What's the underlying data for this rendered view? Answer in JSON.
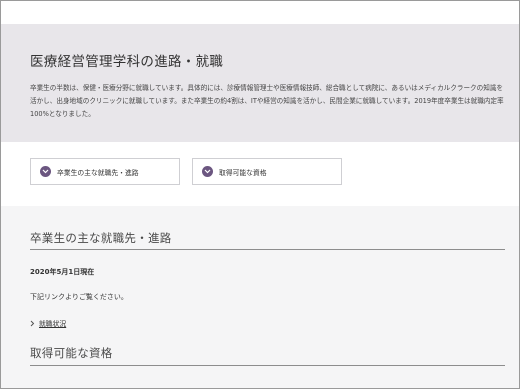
{
  "hero": {
    "title": "医療経営管理学科の進路・就職",
    "description": "卒業生の半数は、保健・医療分野に就職しています。具体的には、診療情報管理士や医療情報技師、総合職として病院に、あるいはメディカルクラークの知識を活かし、出身地域のクリニックに就職しています。また卒業生の約4割は、ITや経営の知識を活かし、民間企業に就職しています。2019年度卒業生は就職内定率100%となりました。"
  },
  "nav_buttons": [
    {
      "label": "卒業生の主な就職先・進路",
      "icon": "chevron-down-icon"
    },
    {
      "label": "取得可能な資格",
      "icon": "chevron-down-icon"
    }
  ],
  "section1": {
    "title": "卒業生の主な就職先・進路",
    "date": "2020年5月1日現在",
    "note": "下記リンクよりご覧ください。",
    "link_label": "就職状況"
  },
  "section2": {
    "title": "取得可能な資格"
  },
  "colors": {
    "hero_bg": "#e8e6ea",
    "accent": "#6b5680",
    "section_bg": "#f5f5f6"
  }
}
